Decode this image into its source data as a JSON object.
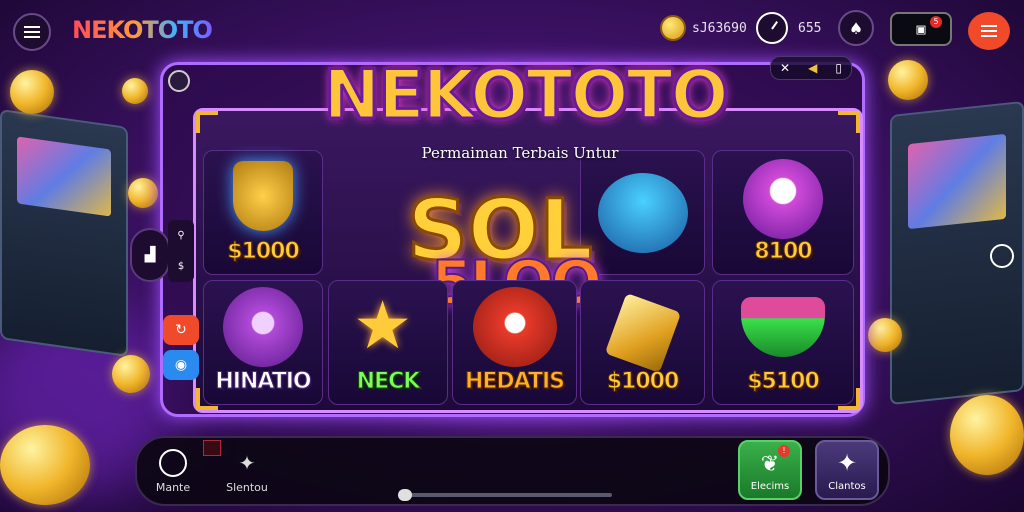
{
  "brand": {
    "name": "NEKOTOTO"
  },
  "topbar": {
    "balance": "sJ63690",
    "timer": "655",
    "notif_label": "ꟷ",
    "notif_count": "5"
  },
  "header": {
    "title": "NEKOTOTO",
    "subtitle": "Permaiman Terbais Untur"
  },
  "center": {
    "headline": "SOL",
    "sub": "5LOO"
  },
  "tiles": [
    {
      "label": "$1000"
    },
    {
      "label": "8100"
    },
    {
      "label": "HINATIO"
    },
    {
      "label": "NECK"
    },
    {
      "label": "HEDATIS"
    },
    {
      "label": "$1000"
    },
    {
      "label": "$5100"
    }
  ],
  "side": {
    "top_symbol": "⚲",
    "mid_symbol": "$"
  },
  "bottom_nav": {
    "left_items": [
      {
        "label": "Mante"
      },
      {
        "label": "Slentou"
      }
    ],
    "right_buttons": [
      {
        "label": "Elecims",
        "badge": "!"
      },
      {
        "label": "Clantos",
        "badge": ""
      }
    ]
  },
  "colors": {
    "accent": "#b06bff",
    "gold": "#ffcb3a",
    "menu_orange": "#f04a2a",
    "green_button": "#2a9a3a",
    "purple_button": "#3a2a60"
  },
  "icons": [
    "menu-icon",
    "coin-icon",
    "clock-icon",
    "spade-icon",
    "notification-icon",
    "list-icon",
    "settings-icon",
    "star-icon",
    "circle-icon"
  ]
}
